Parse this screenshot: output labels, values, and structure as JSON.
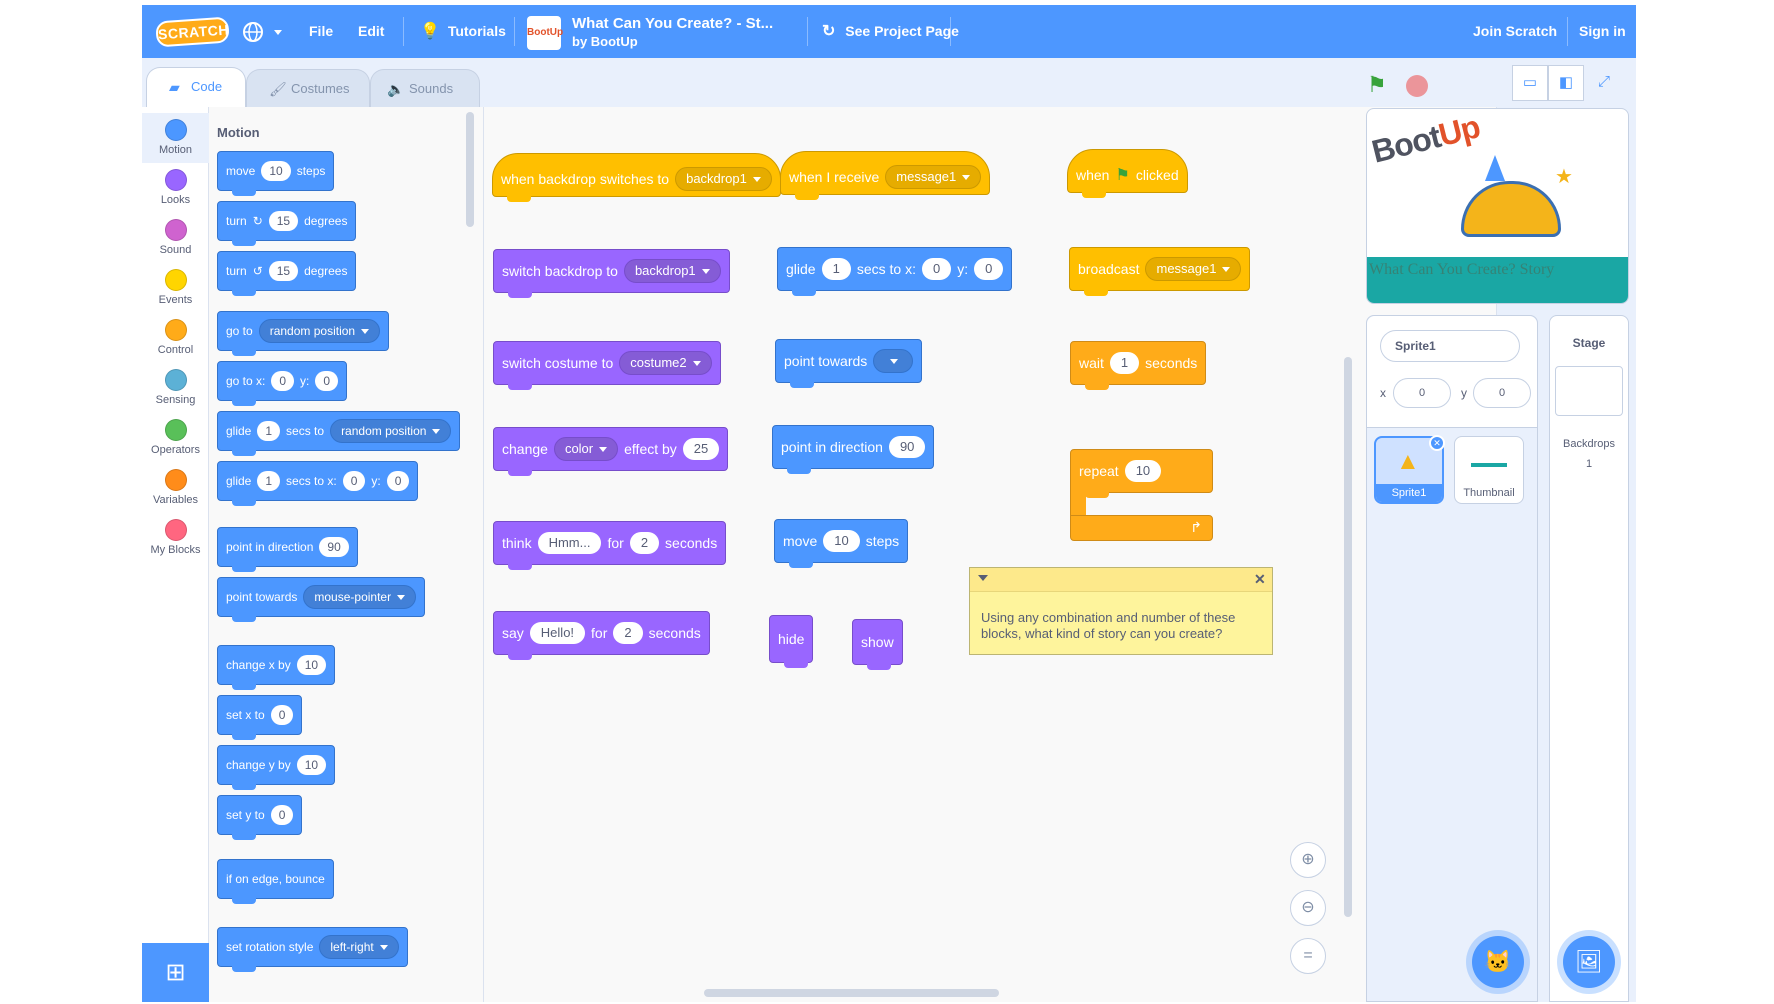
{
  "menubar": {
    "logo": "SCRATCH",
    "file": "File",
    "edit": "Edit",
    "tutorials": "Tutorials",
    "project_thumb": "BootUp",
    "project_title": "What Can You Create? - St...",
    "project_author": "by BootUp",
    "see_project": "See Project Page",
    "join": "Join Scratch",
    "signin": "Sign in"
  },
  "tabs": {
    "code": "Code",
    "costumes": "Costumes",
    "sounds": "Sounds"
  },
  "categories": [
    {
      "label": "Motion",
      "color": "#4c97ff"
    },
    {
      "label": "Looks",
      "color": "#9966ff"
    },
    {
      "label": "Sound",
      "color": "#cf63cf"
    },
    {
      "label": "Events",
      "color": "#ffd500"
    },
    {
      "label": "Control",
      "color": "#ffab19"
    },
    {
      "label": "Sensing",
      "color": "#5cb1d6"
    },
    {
      "label": "Operators",
      "color": "#59c059"
    },
    {
      "label": "Variables",
      "color": "#ff8c1a"
    },
    {
      "label": "My Blocks",
      "color": "#ff6680"
    }
  ],
  "palette": {
    "title": "Motion",
    "move": {
      "a": "move",
      "v": "10",
      "b": "steps"
    },
    "turn_right": {
      "a": "turn",
      "v": "15",
      "b": "degrees"
    },
    "turn_left": {
      "a": "turn",
      "v": "15",
      "b": "degrees"
    },
    "goto": {
      "a": "go to",
      "d": "random position"
    },
    "gotoxy": {
      "a": "go to x:",
      "x": "0",
      "y_label": "y:",
      "y": "0"
    },
    "glide_to": {
      "a": "glide",
      "v": "1",
      "b": "secs to",
      "d": "random position"
    },
    "glide_xy": {
      "a": "glide",
      "v": "1",
      "b": "secs to x:",
      "x": "0",
      "y_label": "y:",
      "y": "0"
    },
    "point_dir": {
      "a": "point in direction",
      "v": "90"
    },
    "point_towards": {
      "a": "point towards",
      "d": "mouse-pointer"
    },
    "change_x": {
      "a": "change x by",
      "v": "10"
    },
    "set_x": {
      "a": "set x to",
      "v": "0"
    },
    "change_y": {
      "a": "change y by",
      "v": "10"
    },
    "set_y": {
      "a": "set y to",
      "v": "0"
    },
    "bounce": {
      "a": "if on edge, bounce"
    },
    "rotation": {
      "a": "set rotation style",
      "d": "left-right"
    }
  },
  "workspace": {
    "backdrop_hat": {
      "a": "when backdrop switches to",
      "d": "backdrop1"
    },
    "receive_hat": {
      "a": "when I receive",
      "d": "message1"
    },
    "flag_hat": {
      "a": "when",
      "b": "clicked"
    },
    "switch_backdrop": {
      "a": "switch backdrop to",
      "d": "backdrop1"
    },
    "glide": {
      "a": "glide",
      "v": "1",
      "b": "secs to x:",
      "x": "0",
      "y_label": "y:",
      "y": "0"
    },
    "broadcast": {
      "a": "broadcast",
      "d": "message1"
    },
    "switch_costume": {
      "a": "switch costume to",
      "d": "costume2"
    },
    "point_towards": {
      "a": "point towards",
      "d": ""
    },
    "wait": {
      "a": "wait",
      "v": "1",
      "b": "seconds"
    },
    "change_effect": {
      "a": "change",
      "d": "color",
      "b": "effect by",
      "v": "25"
    },
    "point_dir": {
      "a": "point in direction",
      "v": "90"
    },
    "repeat": {
      "a": "repeat",
      "v": "10"
    },
    "think": {
      "a": "think",
      "t": "Hmm...",
      "b": "for",
      "v": "2",
      "c": "seconds"
    },
    "move": {
      "a": "move",
      "v": "10",
      "b": "steps"
    },
    "say": {
      "a": "say",
      "t": "Hello!",
      "b": "for",
      "v": "2",
      "c": "seconds"
    },
    "hide": "hide",
    "show": "show"
  },
  "comment": "Using any combination and number of these blocks, what kind of story can you create?",
  "stage": {
    "logo_boot": "Boot",
    "logo_up": "Up",
    "banner_text": "What Can You Create? Story"
  },
  "sprite_info": {
    "name": "Sprite1",
    "x_label": "x",
    "x": "0",
    "y_label": "y",
    "y": "0"
  },
  "sprites": [
    {
      "name": "Sprite1"
    },
    {
      "name": "Thumbnail"
    }
  ],
  "stage_target": {
    "title": "Stage",
    "backdrops_label": "Backdrops",
    "backdrops_count": "1"
  }
}
